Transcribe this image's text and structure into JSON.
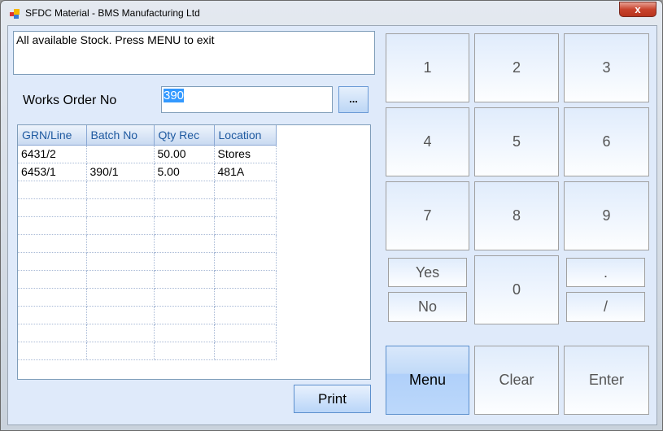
{
  "window": {
    "title": "SFDC Material - BMS Manufacturing Ltd",
    "close": "x"
  },
  "message": "All available Stock. Press MENU to exit",
  "works_order": {
    "label": "Works Order No",
    "value": "390",
    "browse": "..."
  },
  "grid": {
    "columns": [
      "GRN/Line",
      "Batch No",
      "Qty Rec",
      "Location"
    ],
    "rows": [
      [
        "6431/2",
        "",
        "50.00",
        "Stores"
      ],
      [
        "6453/1",
        "390/1",
        "5.00",
        "481A"
      ],
      [
        "",
        "",
        "",
        ""
      ],
      [
        "",
        "",
        "",
        ""
      ],
      [
        "",
        "",
        "",
        ""
      ],
      [
        "",
        "",
        "",
        ""
      ],
      [
        "",
        "",
        "",
        ""
      ],
      [
        "",
        "",
        "",
        ""
      ],
      [
        "",
        "",
        "",
        ""
      ],
      [
        "",
        "",
        "",
        ""
      ],
      [
        "",
        "",
        "",
        ""
      ],
      [
        "",
        "",
        "",
        ""
      ]
    ]
  },
  "print": "Print",
  "keypad": {
    "k1": "1",
    "k2": "2",
    "k3": "3",
    "k4": "4",
    "k5": "5",
    "k6": "6",
    "k7": "7",
    "k8": "8",
    "k9": "9",
    "k0": "0",
    "yes": "Yes",
    "no": "No",
    "dot": ".",
    "slash": "/",
    "menu": "Menu",
    "clear": "Clear",
    "enter": "Enter"
  }
}
